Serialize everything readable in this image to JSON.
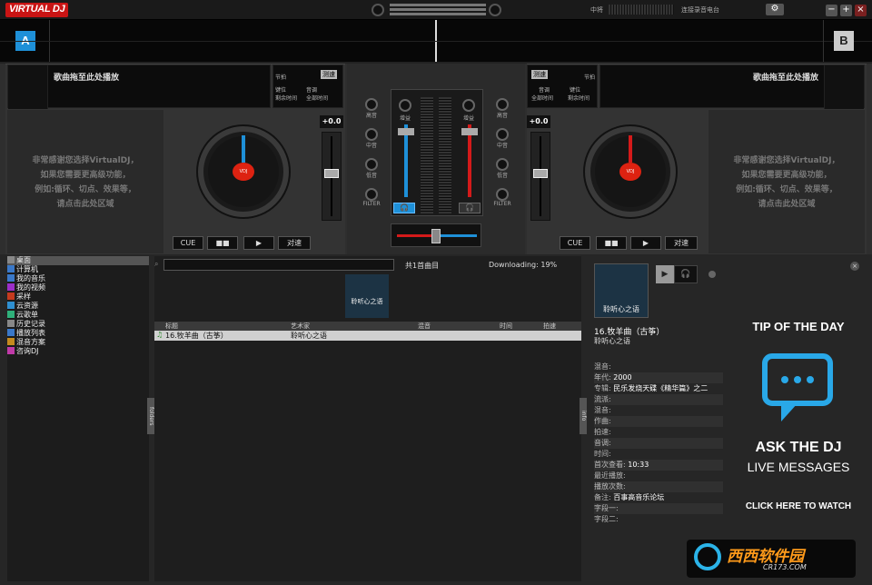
{
  "app": {
    "logo": "VIRTUAL DJ",
    "top_right_label": "中将",
    "top_right_label2": "连接录音电台"
  },
  "window_buttons": [
    "−",
    "+",
    "×"
  ],
  "decks": {
    "a": {
      "letter": "A",
      "song_drop_text": "歌曲拖至此处播放",
      "label1": "节拍",
      "label_speed": "测速",
      "label2": "键位",
      "label3": "剩余时间",
      "label4": "音调",
      "label5": "全部时间",
      "help_lines": [
        "非常感谢您选择VirtualDJ，",
        "如果您需要更高级功能，",
        "例如:循环、切点、效果等，",
        "请点击此处区域"
      ],
      "pitch": "+0.0",
      "buttons": [
        "CUE",
        "■■",
        "▶",
        "对速"
      ]
    },
    "b": {
      "letter": "B",
      "song_drop_text": "歌曲拖至此处播放",
      "label1": "节拍",
      "label_speed": "测速",
      "label2": "音调",
      "label3": "全部时间",
      "label4": "键位",
      "label5": "剩余时间",
      "help_lines": [
        "非常感谢您选择VirtualDJ，",
        "如果您需要更高级功能，",
        "例如:循环、切点、效果等，",
        "请点击此处区域"
      ],
      "pitch": "+0.0",
      "buttons": [
        "CUE",
        "■■",
        "▶",
        "对速"
      ]
    }
  },
  "mixer": {
    "left_knobs": [
      "高音",
      "中音",
      "低音",
      "FILTER"
    ],
    "right_knobs": [
      "高音",
      "中音",
      "低音",
      "FILTER"
    ],
    "gain_left": "增益",
    "gain_right": "增益"
  },
  "browser": {
    "tree": [
      {
        "label": "桌面",
        "color": "#888888"
      },
      {
        "label": "计算机",
        "color": "#3a78c8"
      },
      {
        "label": "我的音乐",
        "color": "#3a78c8"
      },
      {
        "label": "我的视频",
        "color": "#9b2fc9"
      },
      {
        "label": "采样",
        "color": "#c53a1e"
      },
      {
        "label": "云资源",
        "color": "#2f8fd0"
      },
      {
        "label": "云歌单",
        "color": "#2fb07a"
      },
      {
        "label": "历史记录",
        "color": "#888888"
      },
      {
        "label": "播放列表",
        "color": "#3a78c8"
      },
      {
        "label": "混音方案",
        "color": "#c58a1e"
      },
      {
        "label": "咨询DJ",
        "color": "#c03aa8"
      }
    ],
    "sidebar_tab_left": "folders",
    "sidebar_tab_right": "info",
    "search_value": "",
    "track_count": "共1首曲目",
    "downloading": "Downloading: 19%",
    "thumb_text": "聆听心之语",
    "columns": [
      "标题",
      "艺术家",
      "混音",
      "时间",
      "拍速"
    ],
    "rows": [
      {
        "title": "16.牧羊曲（古筝）",
        "artist": "聆听心之语",
        "remix": "",
        "time": "",
        "bpm": ""
      }
    ]
  },
  "info": {
    "cover_text": "聆听心之语",
    "title": "16.牧羊曲（古筝）",
    "artist": "聆听心之语",
    "fields": [
      {
        "label": "混音:",
        "value": ""
      },
      {
        "label": "年代:",
        "value": "2000"
      },
      {
        "label": "专辑:",
        "value": "民乐发烧天碟《精华篇》之二"
      },
      {
        "label": "流派:",
        "value": ""
      },
      {
        "label": "混音:",
        "value": ""
      },
      {
        "label": "作曲:",
        "value": ""
      },
      {
        "label": "拍速:",
        "value": ""
      },
      {
        "label": "音调:",
        "value": ""
      },
      {
        "label": "时间:",
        "value": ""
      },
      {
        "label": "首次查看:",
        "value": "10:33"
      },
      {
        "label": "最近播放:",
        "value": ""
      },
      {
        "label": "播放次数:",
        "value": ""
      },
      {
        "label": "备注:",
        "value": "百事高音乐论坛"
      },
      {
        "label": "字段一:",
        "value": ""
      },
      {
        "label": "字段二:",
        "value": ""
      }
    ]
  },
  "ad": {
    "tip": "TIP OF THE DAY",
    "ask": "ASK THE DJ",
    "live": "LIVE MESSAGES",
    "click_prefix": "CLICK ",
    "click_here": "HERE",
    "click_suffix": " TO WATCH"
  },
  "watermark": {
    "text": "西西软件园",
    "sub": "CR173.COM"
  },
  "colors": {
    "accent_a": "#1e90d8",
    "accent_b": "#d41a1a"
  }
}
